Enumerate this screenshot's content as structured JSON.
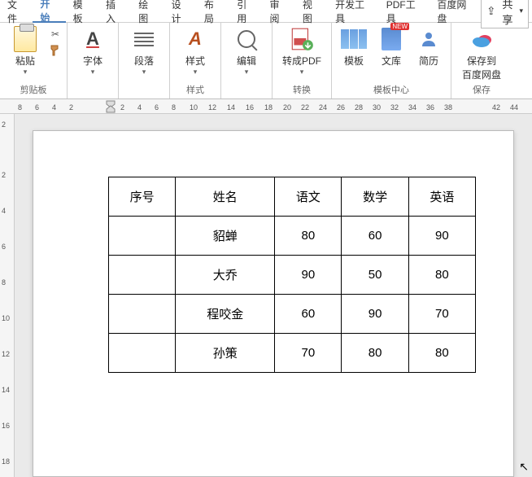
{
  "menubar": {
    "items": [
      "文件",
      "开始",
      "模板",
      "插入",
      "绘图",
      "设计",
      "布局",
      "引用",
      "审阅",
      "视图",
      "开发工具",
      "PDF工具",
      "百度网盘"
    ],
    "active_index": 1,
    "share_label": "共享"
  },
  "ribbon": {
    "clipboard": {
      "paste": "粘贴",
      "label": "剪贴板"
    },
    "font": {
      "btn": "字体"
    },
    "paragraph": {
      "btn": "段落"
    },
    "styles": {
      "btn": "样式",
      "label": "样式"
    },
    "editing": {
      "btn": "编辑"
    },
    "convert": {
      "btn": "转成PDF",
      "label": "转换"
    },
    "template_center": {
      "template": "模板",
      "wenku": "文库",
      "wenku_badge": "NEW",
      "resume": "简历",
      "label": "模板中心"
    },
    "save": {
      "btn_l1": "保存到",
      "btn_l2": "百度网盘",
      "label": "保存"
    }
  },
  "ruler": {
    "h_numbers": [
      "8",
      "6",
      "4",
      "2",
      "2",
      "4",
      "6",
      "8",
      "10",
      "12",
      "14",
      "16",
      "18",
      "20",
      "22",
      "24",
      "26",
      "28",
      "30",
      "32",
      "34",
      "36",
      "38",
      "42",
      "44"
    ],
    "v_numbers": [
      "2",
      "2",
      "4",
      "6",
      "8",
      "10",
      "12",
      "14",
      "16",
      "18"
    ]
  },
  "chart_data": {
    "type": "table",
    "headers": [
      "序号",
      "姓名",
      "语文",
      "数学",
      "英语"
    ],
    "rows": [
      [
        "",
        "貂蝉",
        "80",
        "60",
        "90"
      ],
      [
        "",
        "大乔",
        "90",
        "50",
        "80"
      ],
      [
        "",
        "程咬金",
        "60",
        "90",
        "70"
      ],
      [
        "",
        "孙策",
        "70",
        "80",
        "80"
      ]
    ]
  }
}
